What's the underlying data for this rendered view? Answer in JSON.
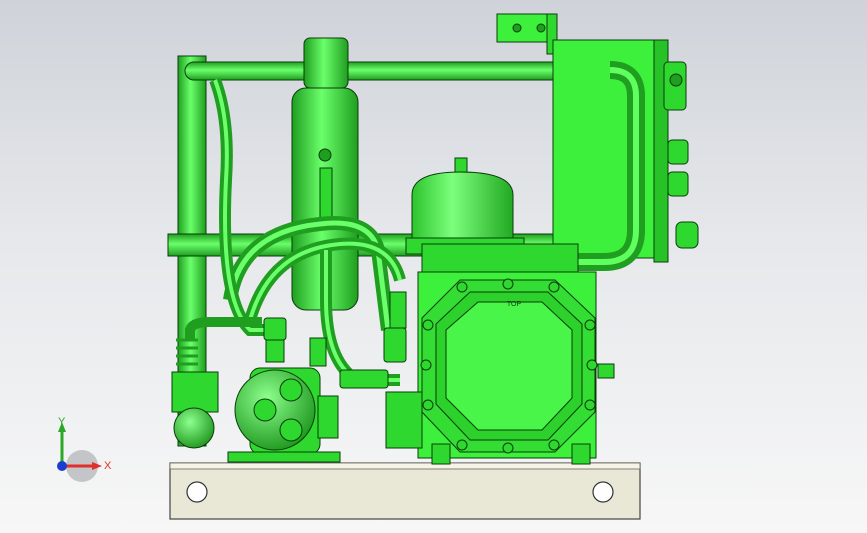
{
  "viewport": {
    "background_top": "#cfd3d9",
    "background_bottom": "#f7f7f7"
  },
  "model": {
    "body_color": "#3cf03c",
    "shade_color": "#1f9e1f",
    "edge_color": "#0a3d0a",
    "base_color": "#e9e8d7",
    "compressor_label": "TOP"
  },
  "triad": {
    "x_label": "X",
    "y_label": "Y",
    "x_color": "#e0302a",
    "y_color": "#2aa82a",
    "z_color": "#1a3fd0"
  }
}
